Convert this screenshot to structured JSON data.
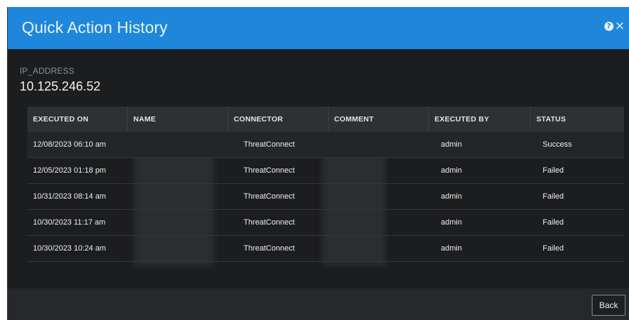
{
  "modal": {
    "title": "Quick Action History",
    "help_icon": "help-icon",
    "close_icon": "close-icon",
    "help_glyph": "?",
    "close_glyph": "×"
  },
  "field": {
    "label": "IP_ADDRESS",
    "value": "10.125.246.52"
  },
  "table": {
    "columns": [
      "EXECUTED ON",
      "NAME",
      "CONNECTOR",
      "COMMENT",
      "EXECUTED BY",
      "STATUS"
    ],
    "rows": [
      {
        "executed_on": "12/08/2023 06:10 am",
        "name": "",
        "connector": "ThreatConnect",
        "comment": "",
        "executed_by": "admin",
        "status": "Success"
      },
      {
        "executed_on": "12/05/2023 01:18 pm",
        "name": "",
        "connector": "ThreatConnect",
        "comment": "",
        "executed_by": "admin",
        "status": "Failed"
      },
      {
        "executed_on": "10/31/2023 08:14 am",
        "name": "",
        "connector": "ThreatConnect",
        "comment": "",
        "executed_by": "admin",
        "status": "Failed"
      },
      {
        "executed_on": "10/30/2023 11:17 am",
        "name": "",
        "connector": "ThreatConnect",
        "comment": "",
        "executed_by": "admin",
        "status": "Failed"
      },
      {
        "executed_on": "10/30/2023 10:24 am",
        "name": "",
        "connector": "ThreatConnect",
        "comment": "",
        "executed_by": "admin",
        "status": "Failed"
      }
    ]
  },
  "footer": {
    "back_label": "Back"
  },
  "colors": {
    "header_blue": "#1f87db",
    "modal_bg": "#1c1d1f",
    "table_header_bg": "#2e3033"
  }
}
